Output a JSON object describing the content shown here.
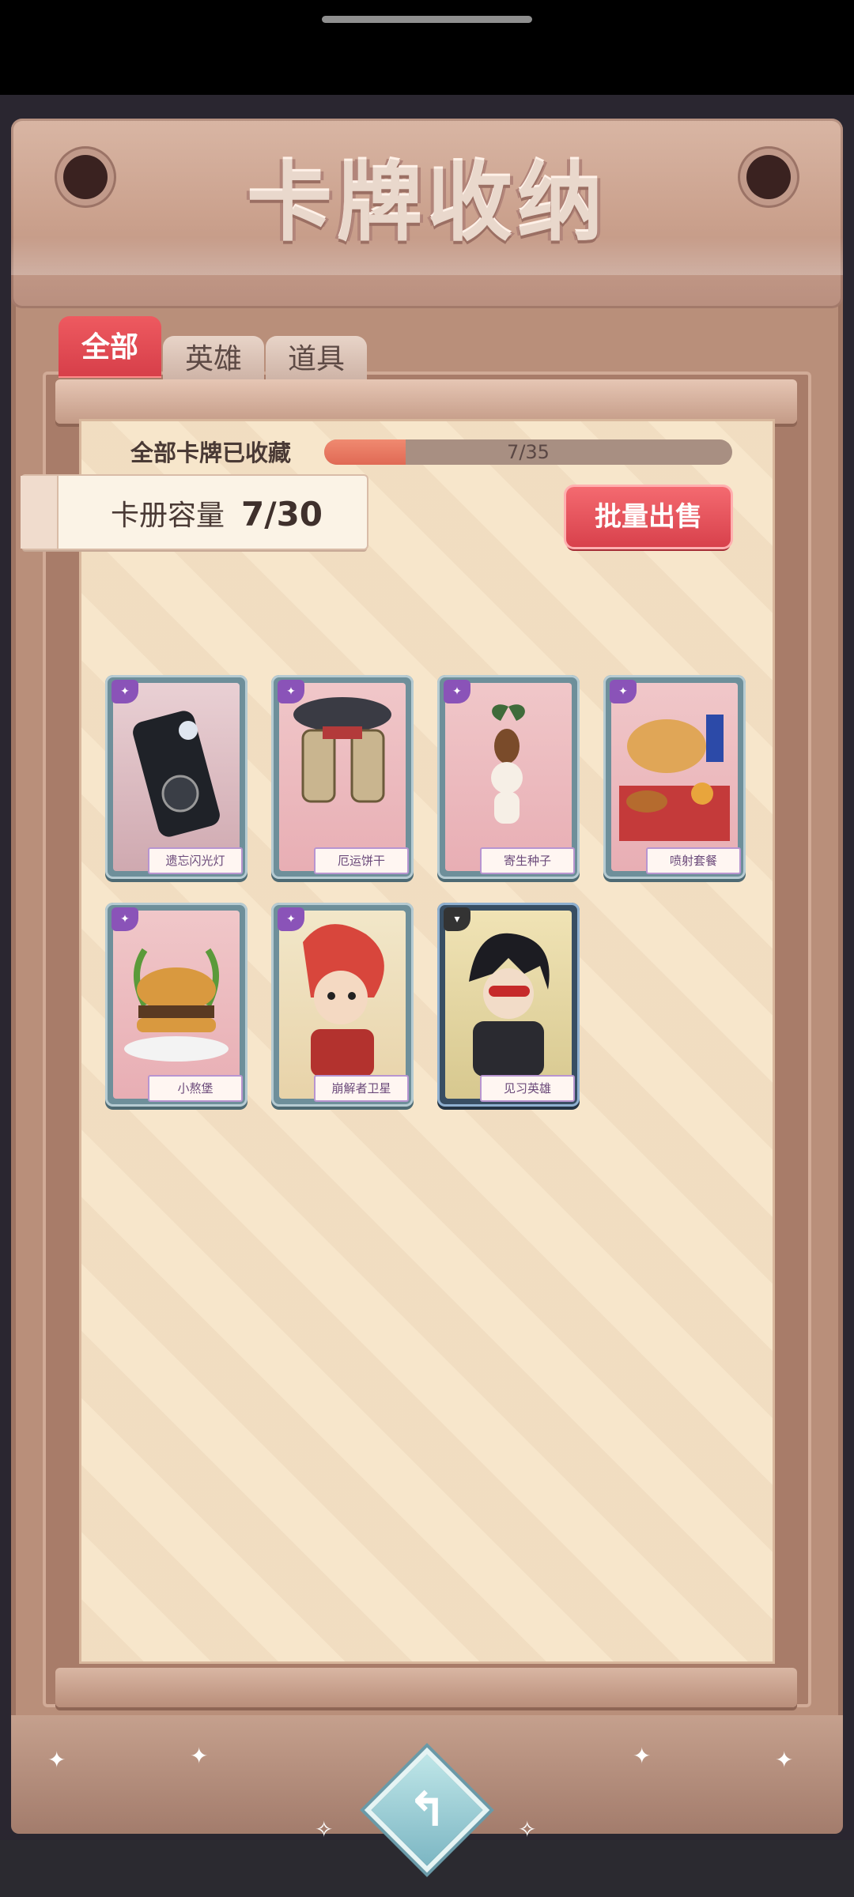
{
  "header": {
    "title": "卡牌收纳"
  },
  "tabs": [
    {
      "label": "全部",
      "active": true
    },
    {
      "label": "英雄",
      "active": false
    },
    {
      "label": "道具",
      "active": false
    }
  ],
  "collection": {
    "label": "全部卡牌已收藏",
    "progress_text": "7/35",
    "progress": 0.2
  },
  "capacity": {
    "label": "卡册容量",
    "value": "7/30"
  },
  "bulk_sell": {
    "label": "批量出售"
  },
  "cards": [
    {
      "name": "遗忘闪光灯"
    },
    {
      "name": "厄运饼干"
    },
    {
      "name": "寄生种子"
    },
    {
      "name": "喷射套餐"
    },
    {
      "name": "小熬堡"
    },
    {
      "name": "崩解者卫星"
    },
    {
      "name": "见习英雄"
    }
  ],
  "colors": {
    "accent": "#e04a53",
    "paper": "#f7e6cb",
    "frame": "#b98f7a"
  },
  "icons": {
    "back": "back-arrow-icon"
  }
}
